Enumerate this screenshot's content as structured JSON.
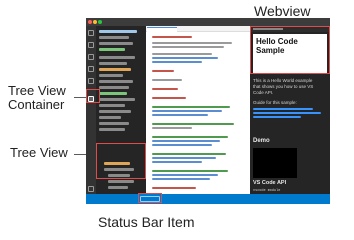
{
  "callouts": {
    "webview": "Webview",
    "tree_view_container_line1": "Tree View",
    "tree_view_container_line2": "Container",
    "tree_view": "Tree View",
    "status_bar_item": "Status Bar Item"
  },
  "webview_panel": {
    "heading_line1": "Hello Code",
    "heading_line2": "Sample",
    "intro_line1": "This is a Hello World example",
    "intro_line2": "that shows you how to use VS",
    "intro_line3": "Code API.",
    "guide_label": "Guide for this sample:",
    "demo_heading": "Demo",
    "api_heading": "VS Code API",
    "api_code": "vscode module"
  },
  "colors": {
    "highlight": "#e04b4b",
    "status_bar": "#007acc",
    "leader_line": "#5a5a5a"
  }
}
